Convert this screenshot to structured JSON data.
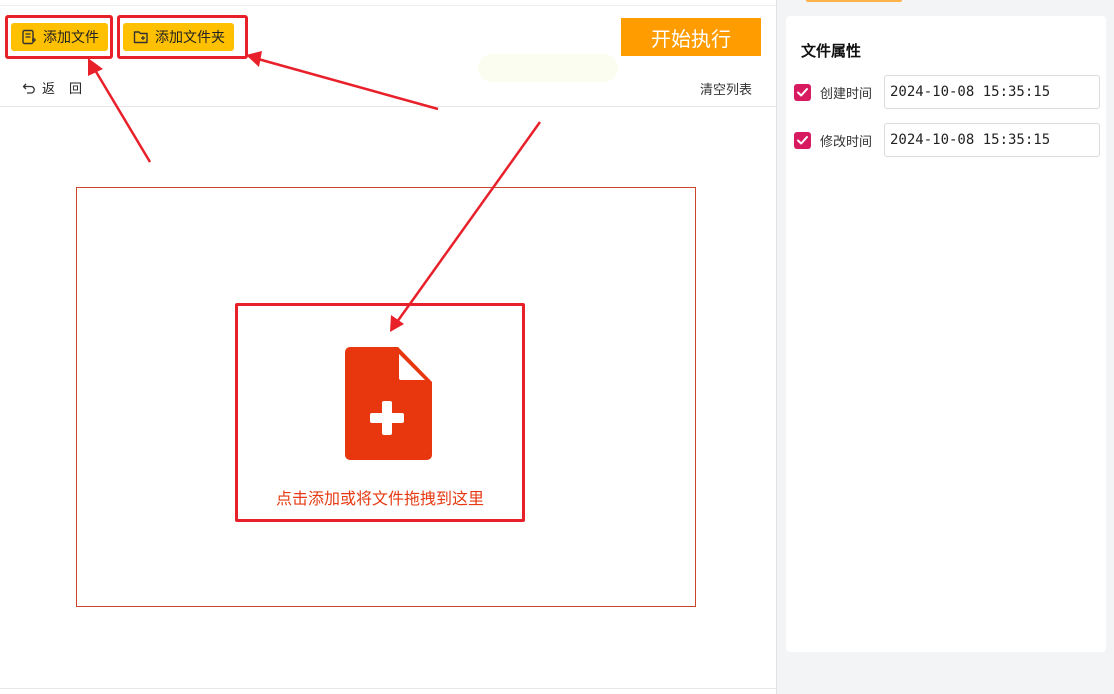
{
  "toolbar": {
    "add_file_label": "添加文件",
    "add_folder_label": "添加文件夹",
    "start_label": "开始执行",
    "back_label": "返回",
    "clear_label": "清空列表"
  },
  "drop_zone": {
    "hint": "点击添加或将文件拖拽到这里"
  },
  "properties": {
    "title": "文件属性",
    "created": {
      "label": "创建时间",
      "value": "2024-10-08 15:35:15",
      "checked": true
    },
    "modified": {
      "label": "修改时间",
      "value": "2024-10-08 15:35:15",
      "checked": true
    }
  },
  "colors": {
    "accent_yellow": "#ffc000",
    "start_orange": "#ff9c00",
    "highlight_red": "#e8202a",
    "file_icon_red": "#e8360e",
    "checkbox_pink": "#d81b60"
  },
  "icons": [
    "add-file-icon",
    "add-folder-icon",
    "undo-icon",
    "file-plus-icon",
    "check-icon"
  ]
}
